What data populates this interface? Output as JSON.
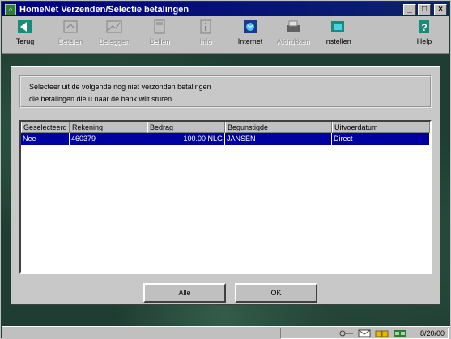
{
  "window": {
    "title": "HomeNet  Verzenden/Selectie betalingen",
    "controls": [
      "minimize",
      "maximize",
      "close"
    ]
  },
  "toolbar": {
    "items": [
      {
        "label": "Terug",
        "icon": "back-arrow-icon",
        "enabled": true
      },
      {
        "label": "Betalen",
        "icon": "payment-icon",
        "enabled": false
      },
      {
        "label": "Beleggen",
        "icon": "invest-icon",
        "enabled": false
      },
      {
        "label": "Bellen",
        "icon": "phone-icon",
        "enabled": false
      },
      {
        "label": "Info",
        "icon": "info-icon",
        "enabled": false
      },
      {
        "label": "Internet",
        "icon": "internet-icon",
        "enabled": true
      },
      {
        "label": "Afdrukken",
        "icon": "printer-icon",
        "enabled": false
      },
      {
        "label": "Instellen",
        "icon": "settings-icon",
        "enabled": true
      },
      {
        "label": "Help",
        "icon": "help-icon",
        "enabled": true
      }
    ]
  },
  "instructions": {
    "line1": "Selecteer uit de volgende nog niet verzonden betalingen",
    "line2": "die betalingen die u naar de bank wilt sturen"
  },
  "table": {
    "columns": [
      "Geselecteerd",
      "Rekening",
      "Bedrag",
      "Begunstigde",
      "Uitvoerdatum"
    ],
    "rows": [
      [
        "Nee",
        "460379",
        "100.00 NLG",
        "JANSEN",
        "Direct"
      ]
    ]
  },
  "buttons": {
    "all_label": "Alle",
    "ok_label": "OK"
  },
  "statusbar": {
    "date": "8/20/00"
  },
  "colors": {
    "titlebar": "#000080",
    "selection": "#0000a0",
    "desktop": "#1f3d32"
  }
}
